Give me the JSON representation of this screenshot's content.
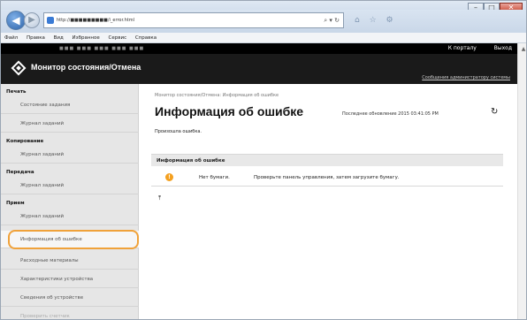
{
  "browser": {
    "url": "http://■■■■■■■■■/i_error.html",
    "menu": [
      "Файл",
      "Правка",
      "Вид",
      "Избранное",
      "Сервис",
      "Справка"
    ]
  },
  "page": {
    "device_strip": "■■■ ■■■  ■■■ ■■■ ■■■",
    "to_portal": "К порталу",
    "logout": "Выход",
    "app_title": "Монитор состояния/Отмена",
    "admin_message": "Сообщения администратору системы"
  },
  "sidebar": {
    "sections": [
      {
        "title": "Печать",
        "items": [
          "Состояние задания",
          "Журнал заданий"
        ]
      },
      {
        "title": "Копирование",
        "items": [
          "Журнал заданий"
        ]
      },
      {
        "title": "Передача",
        "items": [
          "Журнал заданий"
        ]
      },
      {
        "title": "Прием",
        "items": [
          "Журнал заданий"
        ]
      }
    ],
    "extra": [
      "Информация об ошибке",
      "Расходные материалы",
      "Характеристики устройства",
      "Сведения об устройстве",
      "Проверить счетчик"
    ]
  },
  "main": {
    "breadcrumb": "Монитор состояния/Отмена: Информация об ошибке",
    "heading": "Информация об ошибке",
    "last_updated": "Последнее обновление 2015 03:41:05 PM",
    "status": "Произошла ошибка.",
    "section_title": "Информация об ошибке",
    "error": {
      "name": "Нет бумаги.",
      "description": "Проверьте панель управления, затем загрузите бумагу."
    }
  },
  "colors": {
    "header_bg": "#1a1a1a",
    "highlight": "#f0a23a",
    "warning": "#f4a020"
  }
}
